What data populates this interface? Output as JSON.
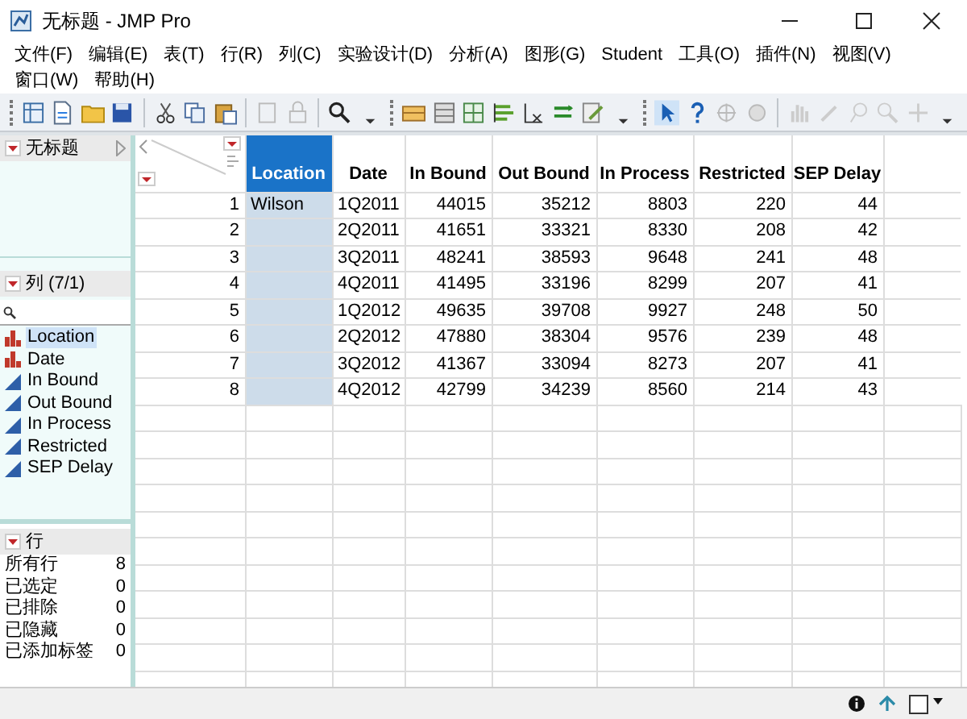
{
  "window": {
    "title": "无标题 - JMP Pro"
  },
  "menu": [
    "文件(F)",
    "编辑(E)",
    "表(T)",
    "行(R)",
    "列(C)",
    "实验设计(D)",
    "分析(A)",
    "图形(G)",
    "Student",
    "工具(O)",
    "插件(N)",
    "视图(V)",
    "窗口(W)",
    "帮助(H)"
  ],
  "table_panel": {
    "title": "无标题"
  },
  "columns_panel": {
    "title": "列 (7/1)",
    "columns": [
      {
        "name": "Location",
        "kind": "nominal",
        "selected": true
      },
      {
        "name": "Date",
        "kind": "nominal",
        "selected": false
      },
      {
        "name": "In Bound",
        "kind": "continuous",
        "selected": false
      },
      {
        "name": "Out Bound",
        "kind": "continuous",
        "selected": false
      },
      {
        "name": "In Process",
        "kind": "continuous",
        "selected": false
      },
      {
        "name": "Restricted",
        "kind": "continuous",
        "selected": false
      },
      {
        "name": "SEP Delay",
        "kind": "continuous",
        "selected": false
      }
    ]
  },
  "rows_panel": {
    "title": "行",
    "items": [
      {
        "label": "所有行",
        "count": "8"
      },
      {
        "label": "已选定",
        "count": "0"
      },
      {
        "label": "已排除",
        "count": "0"
      },
      {
        "label": "已隐藏",
        "count": "0"
      },
      {
        "label": "已添加标签",
        "count": "0"
      }
    ]
  },
  "table": {
    "columns": [
      {
        "label": "Location",
        "selected": true,
        "kind": "character"
      },
      {
        "label": "Date",
        "selected": false,
        "kind": "character"
      },
      {
        "label": "In Bound",
        "selected": false,
        "kind": "numeric"
      },
      {
        "label": "Out Bound",
        "selected": false,
        "kind": "numeric"
      },
      {
        "label": "In Process",
        "selected": false,
        "kind": "numeric"
      },
      {
        "label": "Restricted",
        "selected": false,
        "kind": "numeric"
      },
      {
        "label": "SEP Delay",
        "selected": false,
        "kind": "numeric"
      }
    ],
    "rows": [
      {
        "number": "1",
        "cells": [
          "Wilson",
          "1Q2011",
          "44015",
          "35212",
          "8803",
          "220",
          "44"
        ]
      },
      {
        "number": "2",
        "cells": [
          "",
          "2Q2011",
          "41651",
          "33321",
          "8330",
          "208",
          "42"
        ]
      },
      {
        "number": "3",
        "cells": [
          "",
          "3Q2011",
          "48241",
          "38593",
          "9648",
          "241",
          "48"
        ]
      },
      {
        "number": "4",
        "cells": [
          "",
          "4Q2011",
          "41495",
          "33196",
          "8299",
          "207",
          "41"
        ]
      },
      {
        "number": "5",
        "cells": [
          "",
          "1Q2012",
          "49635",
          "39708",
          "9927",
          "248",
          "50"
        ]
      },
      {
        "number": "6",
        "cells": [
          "",
          "2Q2012",
          "47880",
          "38304",
          "9576",
          "239",
          "48"
        ]
      },
      {
        "number": "7",
        "cells": [
          "",
          "3Q2012",
          "41367",
          "33094",
          "8273",
          "207",
          "41"
        ]
      },
      {
        "number": "8",
        "cells": [
          "",
          "4Q2012",
          "42799",
          "34239",
          "8560",
          "214",
          "43"
        ]
      }
    ]
  }
}
